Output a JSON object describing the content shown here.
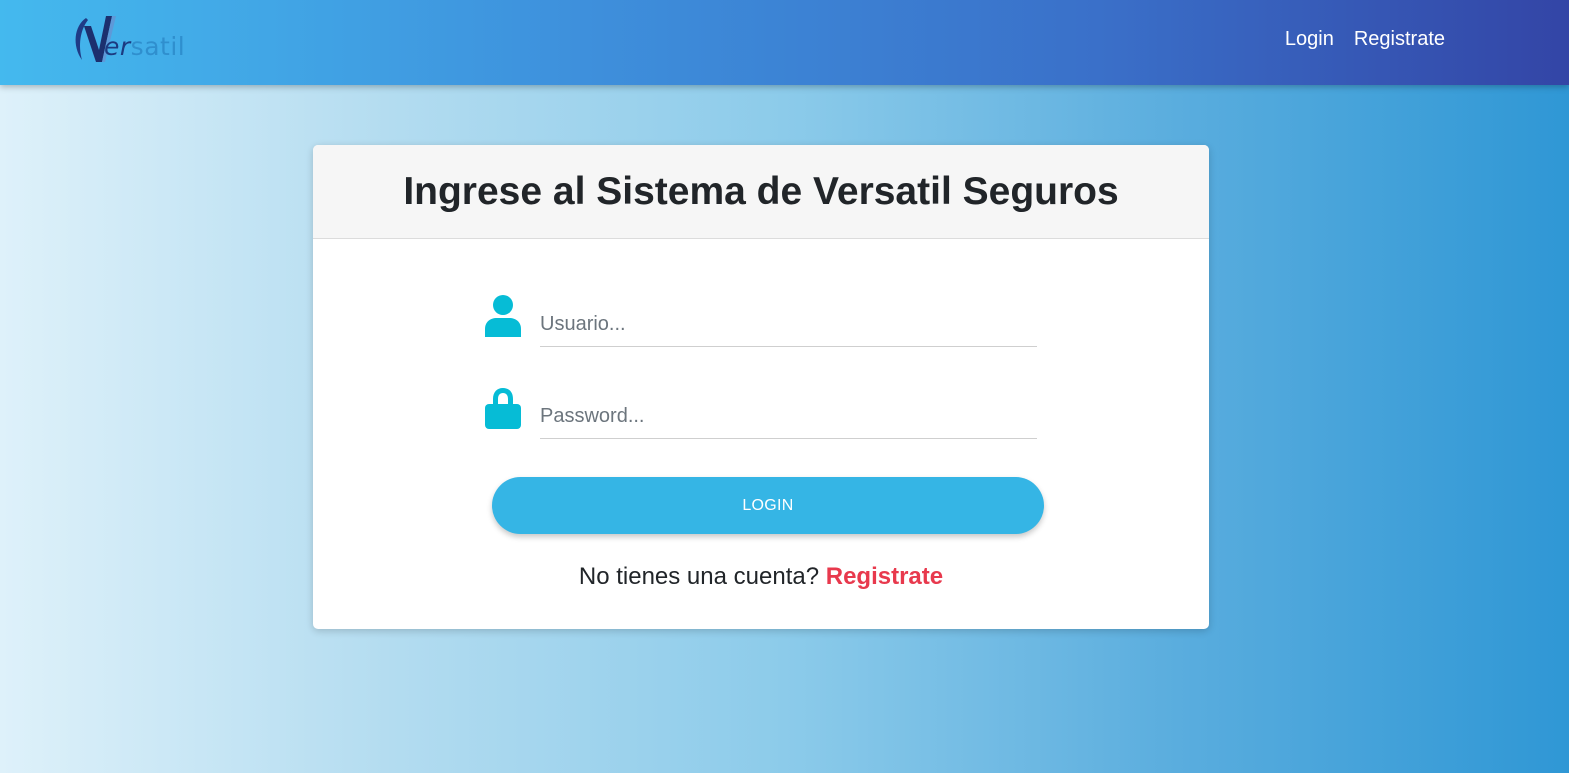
{
  "brand": {
    "logo_text_v": "V",
    "logo_text_er": "er",
    "logo_text_satil": "satil"
  },
  "nav": {
    "login_label": "Login",
    "register_label": "Registrate"
  },
  "card": {
    "title": "Ingrese al Sistema de Versatil Seguros",
    "username": {
      "placeholder": "Usuario...",
      "value": ""
    },
    "password": {
      "placeholder": "Password...",
      "value": ""
    },
    "login_button_label": "LOGIN",
    "no_account_text": "No tienes una cuenta?",
    "register_link_label": "Registrate"
  },
  "colors": {
    "accent_icon": "#06bcd6",
    "login_button": "#35b5e5",
    "register_link": "#e8394d"
  }
}
